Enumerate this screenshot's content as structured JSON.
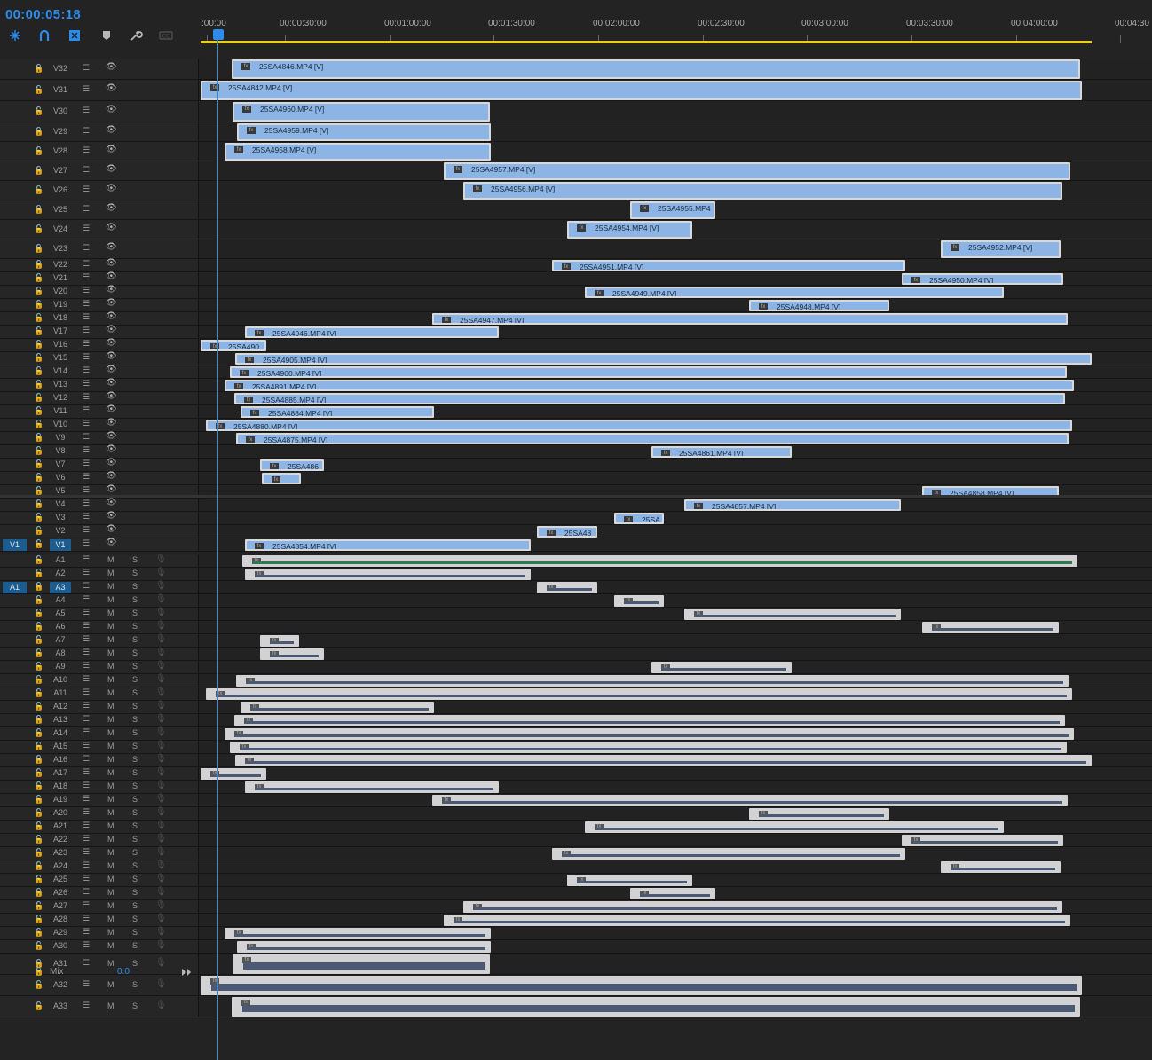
{
  "timecode": "00:00:05:18",
  "ruler": {
    "labels": [
      ":00:00",
      "00:00:30:00",
      "00:01:00:00",
      "00:01:30:00",
      "00:02:00:00",
      "00:02:30:00",
      "00:03:00:00",
      "00:03:30:00",
      "00:04:00:00",
      "00:04:30"
    ]
  },
  "tools": [
    "snap-icon",
    "linked-selection-icon",
    "insert-icon",
    "marker-icon",
    "wrench-icon",
    "captions-icon"
  ],
  "mix": {
    "label": "Mix",
    "value": "0.0"
  },
  "video_tracks": [
    {
      "name": "V32",
      "clips": [
        {
          "label": "25SA4846.MP4 [V]"
        }
      ]
    },
    {
      "name": "V31",
      "clips": [
        {
          "label": "25SA4842.MP4 [V]"
        }
      ]
    },
    {
      "name": "V30",
      "clips": [
        {
          "label": "25SA4960.MP4 [V]"
        }
      ]
    },
    {
      "name": "V29",
      "clips": [
        {
          "label": "25SA4959.MP4 [V]"
        }
      ]
    },
    {
      "name": "V28",
      "clips": [
        {
          "label": "25SA4958.MP4 [V]"
        }
      ]
    },
    {
      "name": "V27",
      "clips": [
        {
          "label": "25SA4957.MP4 [V]"
        }
      ]
    },
    {
      "name": "V26",
      "clips": [
        {
          "label": "25SA4956.MP4 [V]"
        }
      ]
    },
    {
      "name": "V25",
      "clips": [
        {
          "label": "25SA4955.MP4"
        }
      ]
    },
    {
      "name": "V24",
      "clips": [
        {
          "label": "25SA4954.MP4 [V]"
        }
      ]
    },
    {
      "name": "V23",
      "clips": [
        {
          "label": "25SA4952.MP4 [V]"
        }
      ]
    },
    {
      "name": "V22",
      "clips": [
        {
          "label": "25SA4951.MP4 [V]"
        }
      ]
    },
    {
      "name": "V21",
      "clips": [
        {
          "label": "25SA4950.MP4 [V]"
        }
      ]
    },
    {
      "name": "V20",
      "clips": [
        {
          "label": "25SA4949.MP4 [V]"
        }
      ]
    },
    {
      "name": "V19",
      "clips": [
        {
          "label": "25SA4948.MP4 [V]"
        }
      ]
    },
    {
      "name": "V18",
      "clips": [
        {
          "label": "25SA4947.MP4 [V]"
        }
      ]
    },
    {
      "name": "V17",
      "clips": [
        {
          "label": "25SA4946.MP4 [V]"
        }
      ]
    },
    {
      "name": "V16",
      "clips": [
        {
          "label": "25SA490"
        }
      ]
    },
    {
      "name": "V15",
      "clips": [
        {
          "label": "25SA4905.MP4 [V]"
        }
      ]
    },
    {
      "name": "V14",
      "clips": [
        {
          "label": "25SA4900.MP4 [V]"
        }
      ]
    },
    {
      "name": "V13",
      "clips": [
        {
          "label": "25SA4891.MP4 [V]"
        }
      ]
    },
    {
      "name": "V12",
      "clips": [
        {
          "label": "25SA4885.MP4 [V]"
        }
      ]
    },
    {
      "name": "V11",
      "clips": [
        {
          "label": "25SA4884.MP4 [V]"
        }
      ]
    },
    {
      "name": "V10",
      "clips": [
        {
          "label": "25SA4880.MP4 [V]"
        }
      ]
    },
    {
      "name": "V9",
      "clips": [
        {
          "label": "25SA4875.MP4 [V]"
        }
      ]
    },
    {
      "name": "V8",
      "clips": [
        {
          "label": "25SA4861.MP4 [V]"
        }
      ]
    },
    {
      "name": "V7",
      "clips": [
        {
          "label": "25SA486"
        }
      ]
    },
    {
      "name": "V6",
      "clips": [
        {
          "label": ""
        }
      ]
    },
    {
      "name": "V5",
      "clips": [
        {
          "label": "25SA4858.MP4 [V]"
        }
      ]
    },
    {
      "name": "V4",
      "clips": [
        {
          "label": "25SA4857.MP4 [V]"
        }
      ]
    },
    {
      "name": "V3",
      "clips": [
        {
          "label": "25SA"
        }
      ]
    },
    {
      "name": "V2",
      "clips": [
        {
          "label": "25SA48"
        }
      ]
    },
    {
      "name": "V1",
      "source": "V1",
      "clips": [
        {
          "label": "25SA4854.MP4 [V]"
        }
      ]
    }
  ],
  "audio_tracks": [
    {
      "name": "A1"
    },
    {
      "name": "A2"
    },
    {
      "name": "A3",
      "source": "A1"
    },
    {
      "name": "A4"
    },
    {
      "name": "A5"
    },
    {
      "name": "A6"
    },
    {
      "name": "A7"
    },
    {
      "name": "A8"
    },
    {
      "name": "A9"
    },
    {
      "name": "A10"
    },
    {
      "name": "A11"
    },
    {
      "name": "A12"
    },
    {
      "name": "A13"
    },
    {
      "name": "A14"
    },
    {
      "name": "A15"
    },
    {
      "name": "A16"
    },
    {
      "name": "A17"
    },
    {
      "name": "A18"
    },
    {
      "name": "A19"
    },
    {
      "name": "A20"
    },
    {
      "name": "A21"
    },
    {
      "name": "A22"
    },
    {
      "name": "A23"
    },
    {
      "name": "A24"
    },
    {
      "name": "A25"
    },
    {
      "name": "A26"
    },
    {
      "name": "A27"
    },
    {
      "name": "A28"
    },
    {
      "name": "A29"
    },
    {
      "name": "A30"
    },
    {
      "name": "A31"
    },
    {
      "name": "A32"
    },
    {
      "name": "A33"
    }
  ],
  "labels": {
    "mute": "M",
    "solo": "S"
  }
}
